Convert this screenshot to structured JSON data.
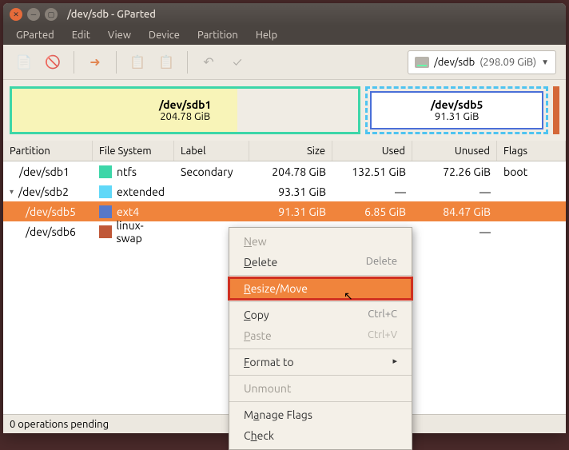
{
  "title": "/dev/sdb - GParted",
  "menubar": [
    "GParted",
    "Edit",
    "View",
    "Device",
    "Partition",
    "Help"
  ],
  "device_selector": {
    "name": "/dev/sdb",
    "size": "(298.09 GiB)"
  },
  "disk_map": {
    "ntfs": {
      "label": "/dev/sdb1",
      "size": "204.78 GiB"
    },
    "ext": {
      "label": "/dev/sdb5",
      "size": "91.31 GiB"
    }
  },
  "columns": {
    "partition": "Partition",
    "fs": "File System",
    "label": "Label",
    "size": "Size",
    "used": "Used",
    "unused": "Unused",
    "flags": "Flags"
  },
  "rows": [
    {
      "partition": "/dev/sdb1",
      "fs": "ntfs",
      "swatch": "sw-ntfs",
      "label": "Secondary",
      "size": "204.78 GiB",
      "used": "132.51 GiB",
      "unused": "72.26 GiB",
      "flags": "boot",
      "indent": 1,
      "expander": ""
    },
    {
      "partition": "/dev/sdb2",
      "fs": "extended",
      "swatch": "sw-ext",
      "label": "",
      "size": "93.31 GiB",
      "used": "—",
      "unused": "—",
      "flags": "",
      "indent": 0,
      "expander": "▾"
    },
    {
      "partition": "/dev/sdb5",
      "fs": "ext4",
      "swatch": "sw-ext4",
      "label": "",
      "size": "91.31 GiB",
      "used": "6.85 GiB",
      "unused": "84.47 GiB",
      "flags": "",
      "indent": 2,
      "expander": "",
      "selected": true
    },
    {
      "partition": "/dev/sdb6",
      "fs": "linux-swap",
      "swatch": "sw-swap",
      "label": "",
      "size": "",
      "used": "—",
      "unused": "—",
      "flags": "",
      "indent": 2,
      "expander": ""
    }
  ],
  "status": "0 operations pending",
  "context_menu": {
    "new": "New",
    "delete": "Delete",
    "delete_shortcut": "Delete",
    "resize": "Resize/Move",
    "copy": "Copy",
    "copy_shortcut": "Ctrl+C",
    "paste": "Paste",
    "paste_shortcut": "Ctrl+V",
    "format": "Format to",
    "unmount": "Unmount",
    "manage_flags": "Manage Flags",
    "check": "Check"
  }
}
